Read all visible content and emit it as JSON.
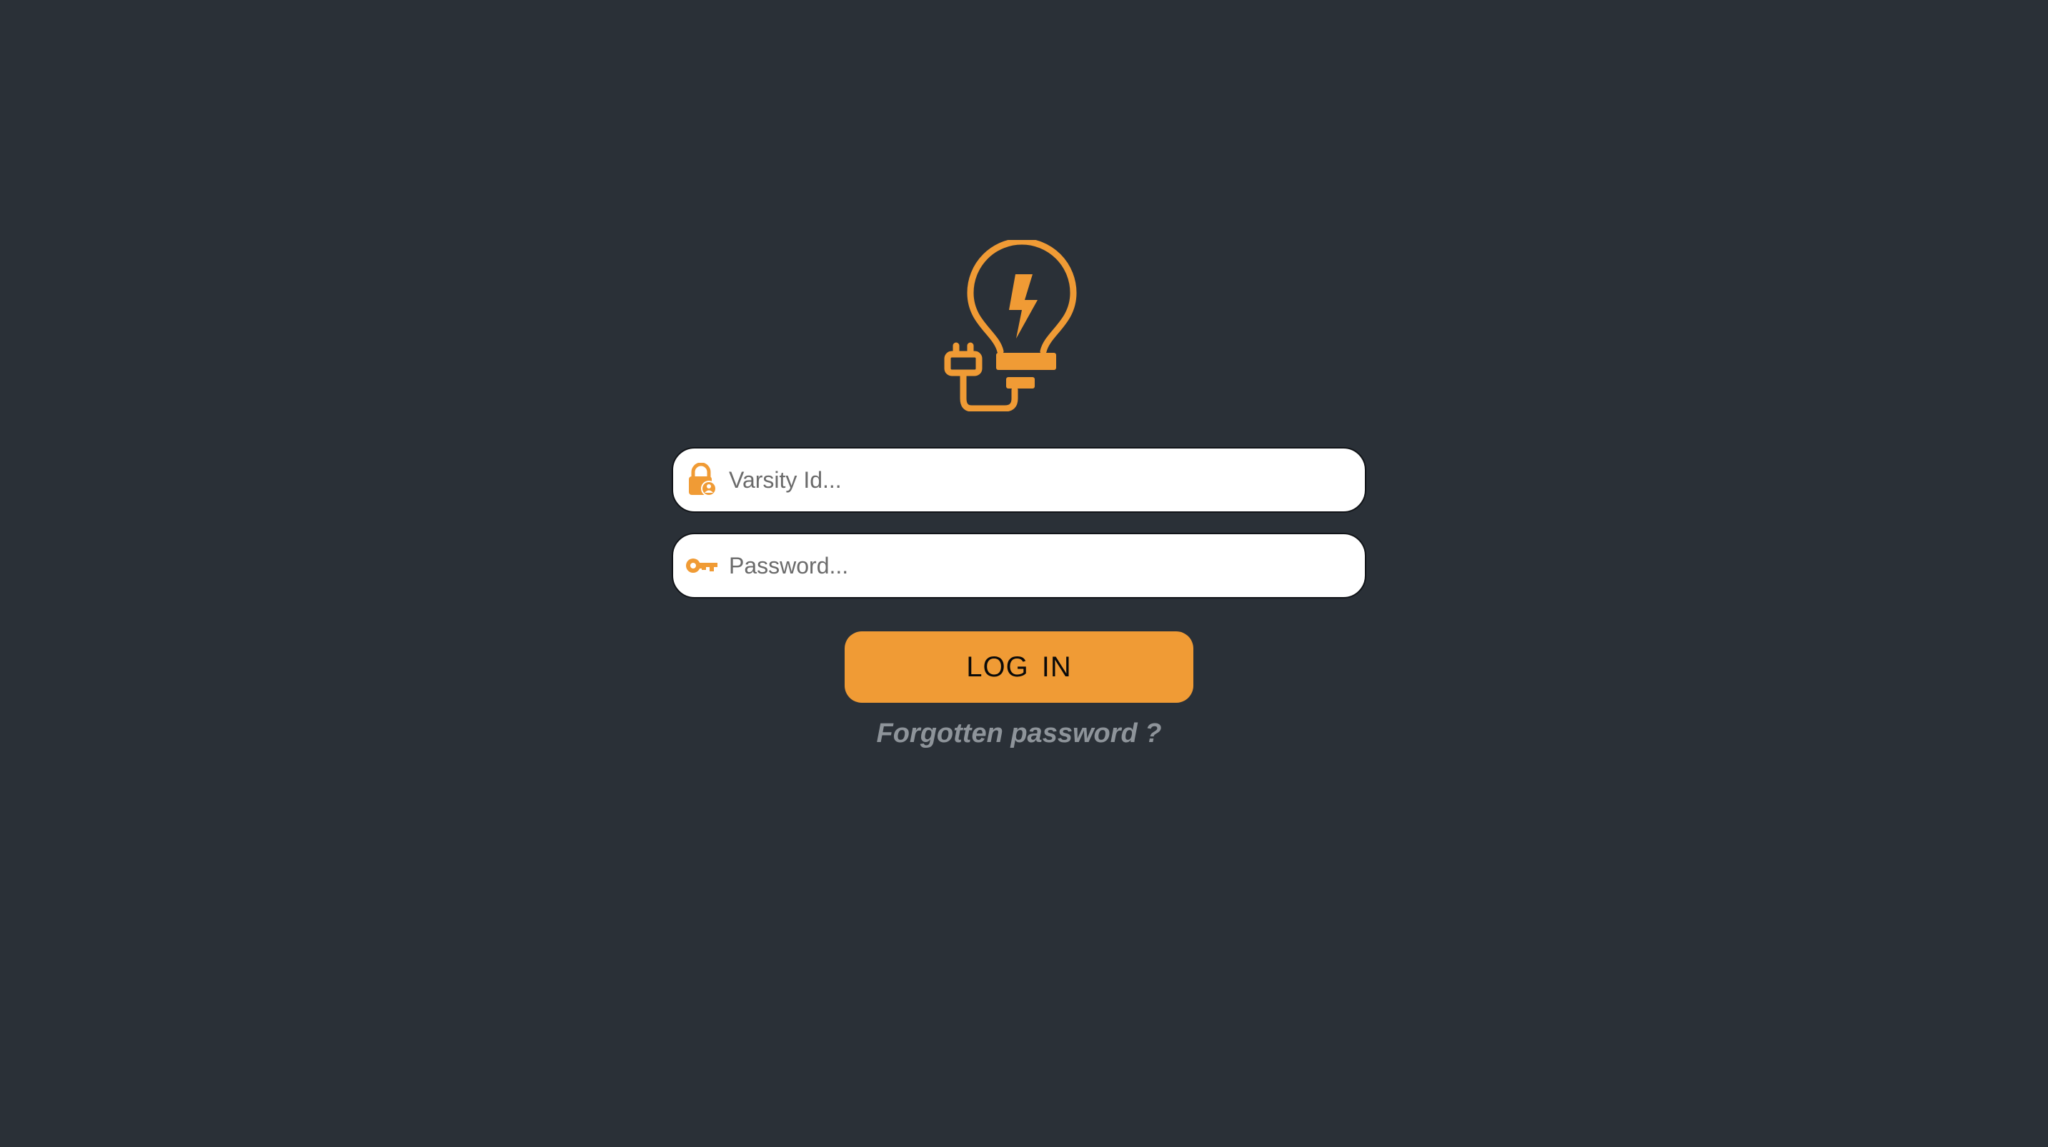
{
  "colors": {
    "background": "#2a3037",
    "accent": "#f09b35",
    "input_background": "#ffffff",
    "link": "#8e949a"
  },
  "logo": {
    "icon": "lightbulb-plug-icon"
  },
  "form": {
    "varsity_id": {
      "icon": "user-lock-icon",
      "placeholder": "Varsity Id...",
      "value": ""
    },
    "password": {
      "icon": "key-icon",
      "placeholder": "Password...",
      "value": ""
    },
    "login_label": "LOG  IN",
    "forgot_label": "Forgotten password ?"
  }
}
